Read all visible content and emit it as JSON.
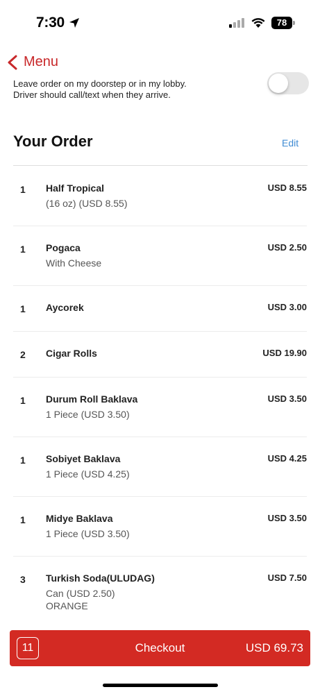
{
  "status_bar": {
    "time": "7:30",
    "battery": "78"
  },
  "nav": {
    "back_label": "Menu"
  },
  "delivery_note": {
    "line1": "Leave order on my doorstep or in my lobby.",
    "line2": "Driver should call/text when they arrive."
  },
  "order": {
    "title": "Your Order",
    "edit_label": "Edit",
    "items": [
      {
        "qty": "1",
        "name": "Half Tropical",
        "sub": "(16 oz) (USD 8.55)",
        "sub2": "",
        "price": "USD 8.55"
      },
      {
        "qty": "1",
        "name": "Pogaca",
        "sub": "With Cheese",
        "sub2": "",
        "price": "USD 2.50"
      },
      {
        "qty": "1",
        "name": "Aycorek",
        "sub": "",
        "sub2": "",
        "price": "USD 3.00"
      },
      {
        "qty": "2",
        "name": "Cigar Rolls",
        "sub": "",
        "sub2": "",
        "price": "USD 19.90"
      },
      {
        "qty": "1",
        "name": "Durum Roll Baklava",
        "sub": "1 Piece (USD 3.50)",
        "sub2": "",
        "price": "USD 3.50"
      },
      {
        "qty": "1",
        "name": "Sobiyet Baklava",
        "sub": "1 Piece (USD 4.25)",
        "sub2": "",
        "price": "USD 4.25"
      },
      {
        "qty": "1",
        "name": "Midye Baklava",
        "sub": "1 Piece (USD 3.50)",
        "sub2": "",
        "price": "USD 3.50"
      },
      {
        "qty": "3",
        "name": "Turkish Soda(ULUDAG)",
        "sub": "Can (USD 2.50)",
        "sub2": "ORANGE",
        "price": "USD 7.50"
      }
    ]
  },
  "checkout": {
    "count": "11",
    "label": "Checkout",
    "total": "USD 69.73"
  },
  "colors": {
    "accent": "#d32a23",
    "link": "#3f8bd3"
  }
}
